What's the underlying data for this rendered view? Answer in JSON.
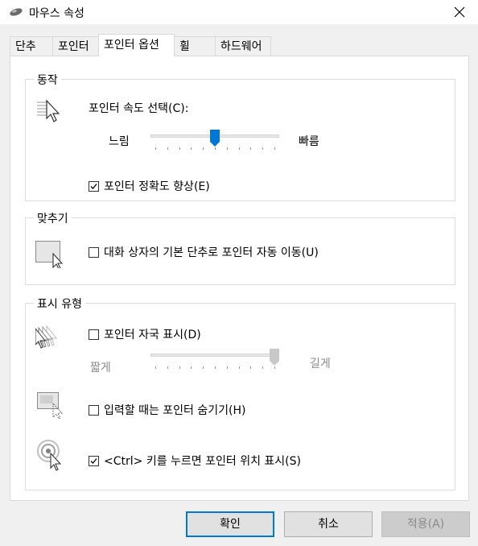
{
  "window": {
    "title": "마우스 속성",
    "app_icon": "mouse-icon",
    "close_icon": "close-icon"
  },
  "tabs": [
    {
      "label": "단추",
      "active": false
    },
    {
      "label": "포인터",
      "active": false
    },
    {
      "label": "포인터 옵션",
      "active": true
    },
    {
      "label": "휠",
      "active": false
    },
    {
      "label": "하드웨어",
      "active": false
    }
  ],
  "motion": {
    "title": "동작",
    "icon": "pointer-speed-icon",
    "speed_label": "포인터 속도 선택(C):",
    "slow_label": "느림",
    "fast_label": "빠름",
    "speed_value": 0.5,
    "enhance_precision": {
      "label": "포인터 정확도 향상(E)",
      "checked": true
    }
  },
  "snap_to": {
    "title": "맞추기",
    "icon": "snap-to-button-icon",
    "option": {
      "label": "대화 상자의 기본 단추로 포인터 자동 이동(U)",
      "checked": false
    }
  },
  "visibility": {
    "title": "표시 유형",
    "trails": {
      "icon": "pointer-trails-icon",
      "label": "포인터 자국 표시(D)",
      "checked": false
    },
    "short_label": "짧게",
    "long_label": "길게",
    "trail_value": 1.0,
    "hide_typing": {
      "icon": "hide-while-typing-icon",
      "label": "입력할 때는 포인터 숨기기(H)",
      "checked": false
    },
    "ctrl_show": {
      "icon": "ctrl-location-icon",
      "label": "<Ctrl> 키를 누르면 포인터 위치 표시(S)",
      "checked": true
    }
  },
  "buttons": {
    "ok": "확인",
    "cancel": "취소",
    "apply": "적용(A)"
  },
  "colors": {
    "accent": "#0078d7",
    "window_bg": "#f0f0f0",
    "panel_bg": "#ffffff"
  }
}
